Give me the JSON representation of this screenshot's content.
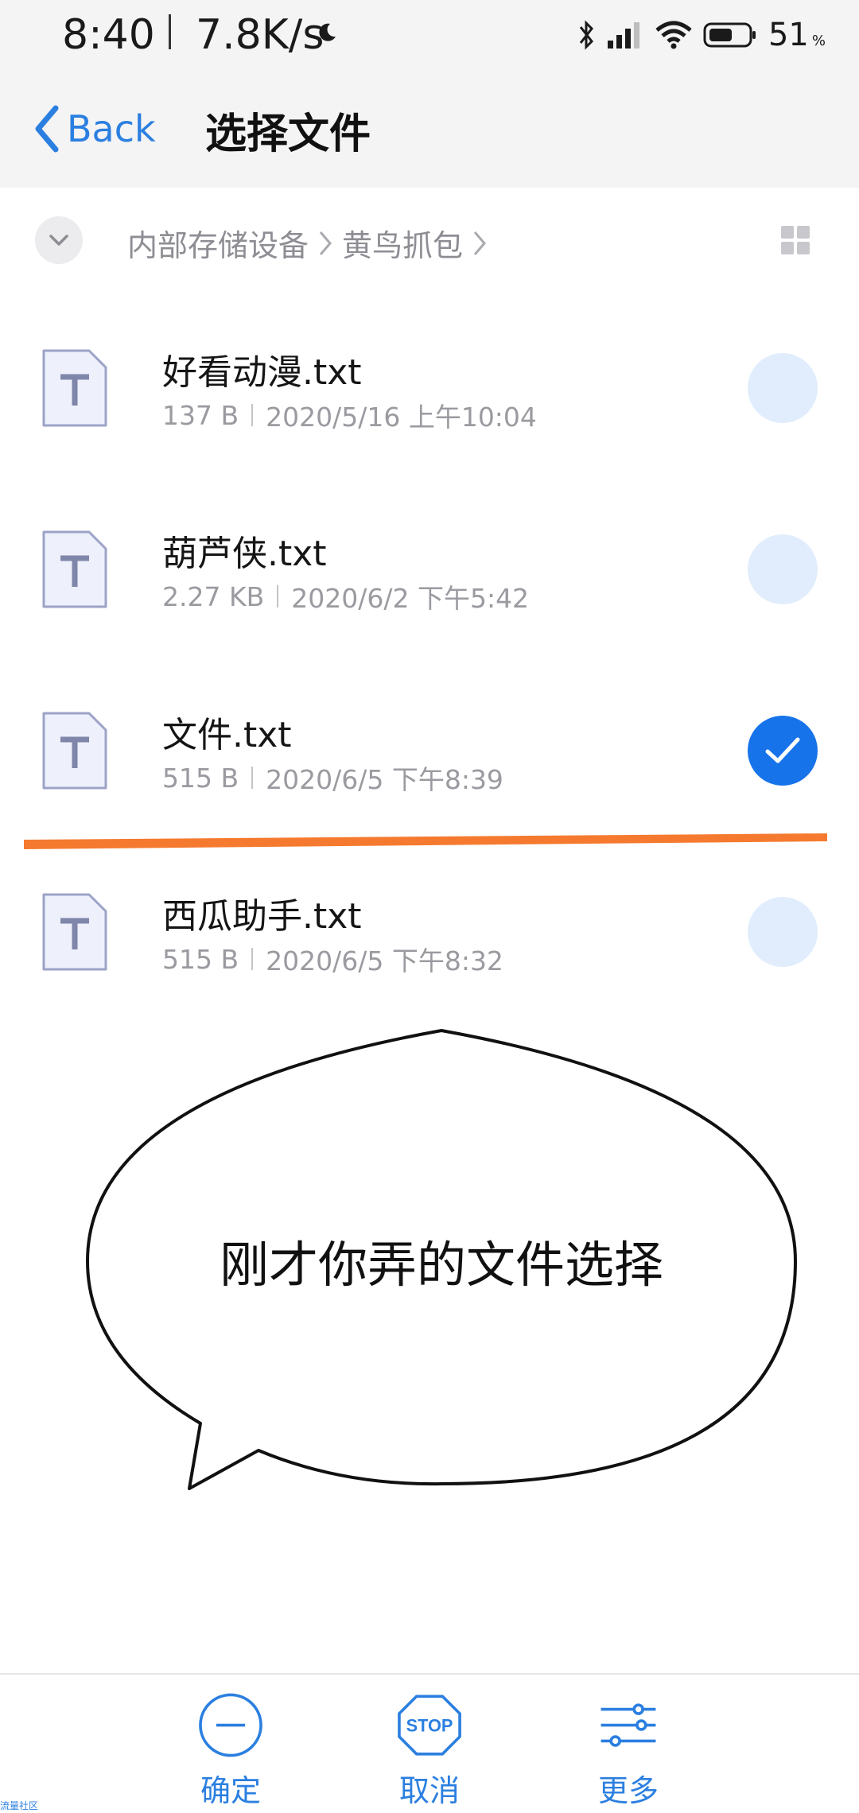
{
  "status_bar": {
    "time": "8:40",
    "net_speed": "7.8K/s",
    "battery": "51",
    "battery_pct_sign": "%"
  },
  "nav": {
    "back_label": "Back",
    "title": "选择文件"
  },
  "breadcrumb": {
    "items": [
      "内部存储设备",
      "黄鸟抓包"
    ]
  },
  "files": [
    {
      "name": "好看动漫.txt",
      "size": "137 B",
      "date": "2020/5/16 上午10:04",
      "selected": false
    },
    {
      "name": "葫芦侠.txt",
      "size": "2.27 KB",
      "date": "2020/6/2 下午5:42",
      "selected": false
    },
    {
      "name": "文件.txt",
      "size": "515 B",
      "date": "2020/6/5 下午8:39",
      "selected": true
    },
    {
      "name": "西瓜助手.txt",
      "size": "515 B",
      "date": "2020/6/5 下午8:32",
      "selected": false
    }
  ],
  "annotation": {
    "bubble_text": "刚才你弄的文件选择",
    "line_color": "#f57a2f"
  },
  "bottom_bar": {
    "confirm_label": "确定",
    "cancel_label": "取消",
    "cancel_icon_text": "STOP",
    "more_label": "更多"
  },
  "watermark": "流量社区",
  "colors": {
    "accent": "#2b7fe0",
    "selected": "#1773ea",
    "unselected": "#e1edfd"
  }
}
